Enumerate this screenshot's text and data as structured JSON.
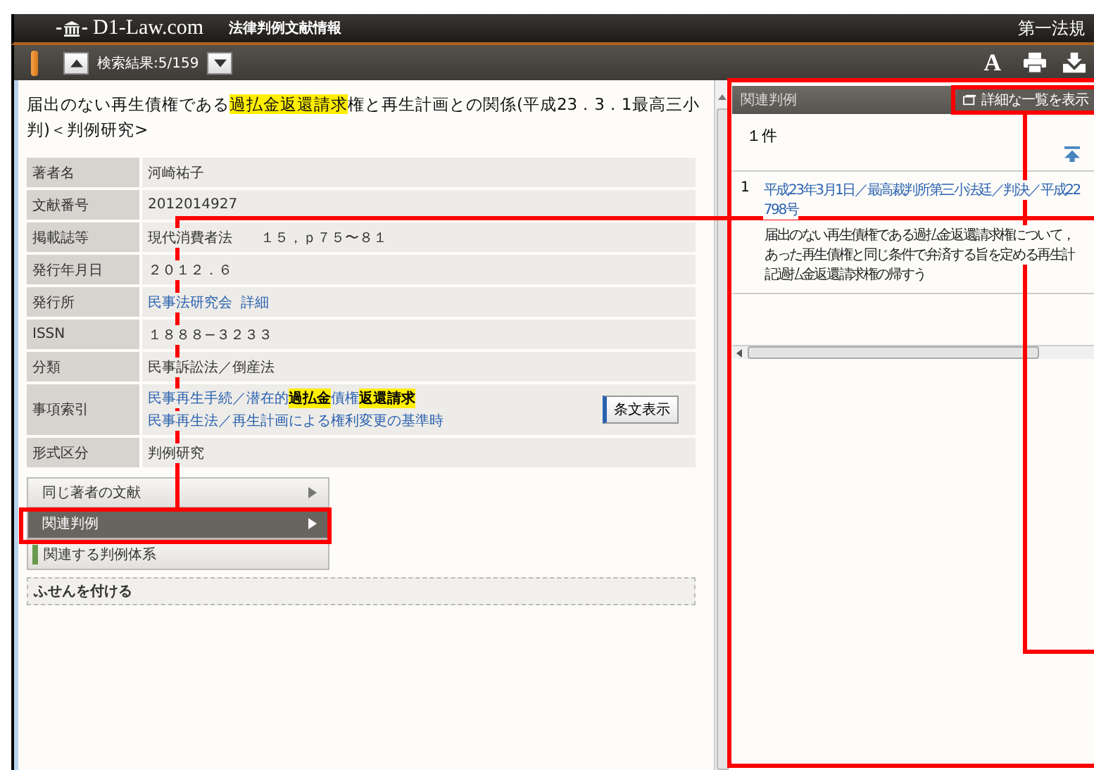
{
  "header": {
    "site": "D1-Law.com",
    "product": "法律判例文献情報",
    "publisher": "第一法規"
  },
  "toolbar": {
    "result_count": "検索結果:5/159",
    "font_button": "A"
  },
  "document": {
    "title": [
      {
        "text": "届出のない再生債権である",
        "highlight": false
      },
      {
        "text": "過払金返還請求",
        "highlight": true
      },
      {
        "text": "権と再生計画との関係(平成23．3．1最高三小判)＜判例研究>",
        "highlight": false
      }
    ],
    "fields": [
      {
        "label": "著者名",
        "value": [
          {
            "text": "河崎祐子",
            "link": false,
            "highlight": false
          }
        ]
      },
      {
        "label": "文献番号",
        "value": [
          {
            "text": "2012014927",
            "link": false,
            "highlight": false
          }
        ]
      },
      {
        "label": "掲載誌等",
        "value": [
          {
            "text": "現代消費者法　　１５，ｐ７５〜８１",
            "link": false,
            "highlight": false
          }
        ]
      },
      {
        "label": "発行年月日",
        "value": [
          {
            "text": "２０１２．６",
            "link": false,
            "highlight": false
          }
        ]
      },
      {
        "label": "発行所",
        "value": [
          {
            "text": "民事法研究会",
            "link": true,
            "highlight": false
          },
          {
            "text": "詳細",
            "link": true,
            "highlight": false
          }
        ]
      },
      {
        "label": "ISSN",
        "value": [
          {
            "text": "１８８８−３２３３",
            "link": false,
            "highlight": false
          }
        ]
      },
      {
        "label": "分類",
        "value": [
          {
            "text": "民事訴訟法／倒産法",
            "link": false,
            "highlight": false
          }
        ]
      },
      {
        "label": "事項索引",
        "value": [
          {
            "text": "民事再生手続／潜在的",
            "link": true,
            "highlight": false
          },
          {
            "text": "過払金",
            "link": true,
            "highlight": true
          },
          {
            "text": "債権",
            "link": true,
            "highlight": false
          },
          {
            "text": "返還請求",
            "link": true,
            "highlight": true
          }
        ],
        "value_2": [
          {
            "text": "民事再生法／再生計画による権利変更の基準時",
            "link": true,
            "highlight": false
          }
        ],
        "button": "条文表示"
      },
      {
        "label": "形式区分",
        "value": [
          {
            "text": "判例研究",
            "link": false,
            "highlight": false
          }
        ]
      }
    ],
    "menu": [
      {
        "label": "同じ著者の文献",
        "kind": "arrow",
        "selected": false
      },
      {
        "label": "関連判例",
        "kind": "arrow",
        "selected": true
      },
      {
        "label": "関連する判例体系",
        "kind": "marker",
        "selected": false
      }
    ],
    "sticky_note": "ふせんを付ける"
  },
  "related": {
    "title": "関連判例",
    "detail_button": "詳細な一覧を表示",
    "count": "１件",
    "results": [
      {
        "number": "1",
        "link_lines": [
          "平成23年3月1日／最高裁判所第三小法廷／判決／平成22",
          "798号"
        ],
        "summary_lines": [
          "届出のない再生債権である過払金返還請求権について，",
          "あった再生債権と同じ条件で弁済する旨を定める再生計",
          "記過払金返還請求権の帰すう"
        ]
      }
    ]
  },
  "annotations": {
    "shown": true
  }
}
